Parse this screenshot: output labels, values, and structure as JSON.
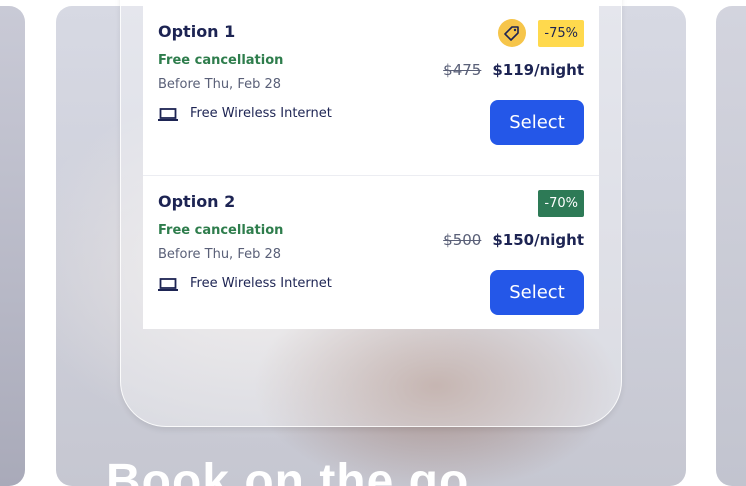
{
  "options": [
    {
      "title": "Option 1",
      "cancellation": "Free cancellation",
      "deadline": "Before Thu, Feb 28",
      "amenity": "Free Wireless Internet",
      "discount": "-75%",
      "old_price": "$475",
      "new_price": "$119/night",
      "select_label": "Select"
    },
    {
      "title": "Option 2",
      "cancellation": "Free cancellation",
      "deadline": "Before Thu, Feb 28",
      "amenity": "Free Wireless Internet",
      "discount": "-70%",
      "old_price": "$500",
      "new_price": "$150/night",
      "select_label": "Select"
    }
  ],
  "card": {
    "headline": "Book on the go"
  },
  "colors": {
    "accent": "#2457e8",
    "navy": "#1d2453",
    "green": "#2e7d4c",
    "badge_yellow": "#ffd94d",
    "badge_green": "#2d7a56"
  },
  "icons": {
    "amenity": "laptop-icon",
    "deal": "price-tag-icon"
  }
}
